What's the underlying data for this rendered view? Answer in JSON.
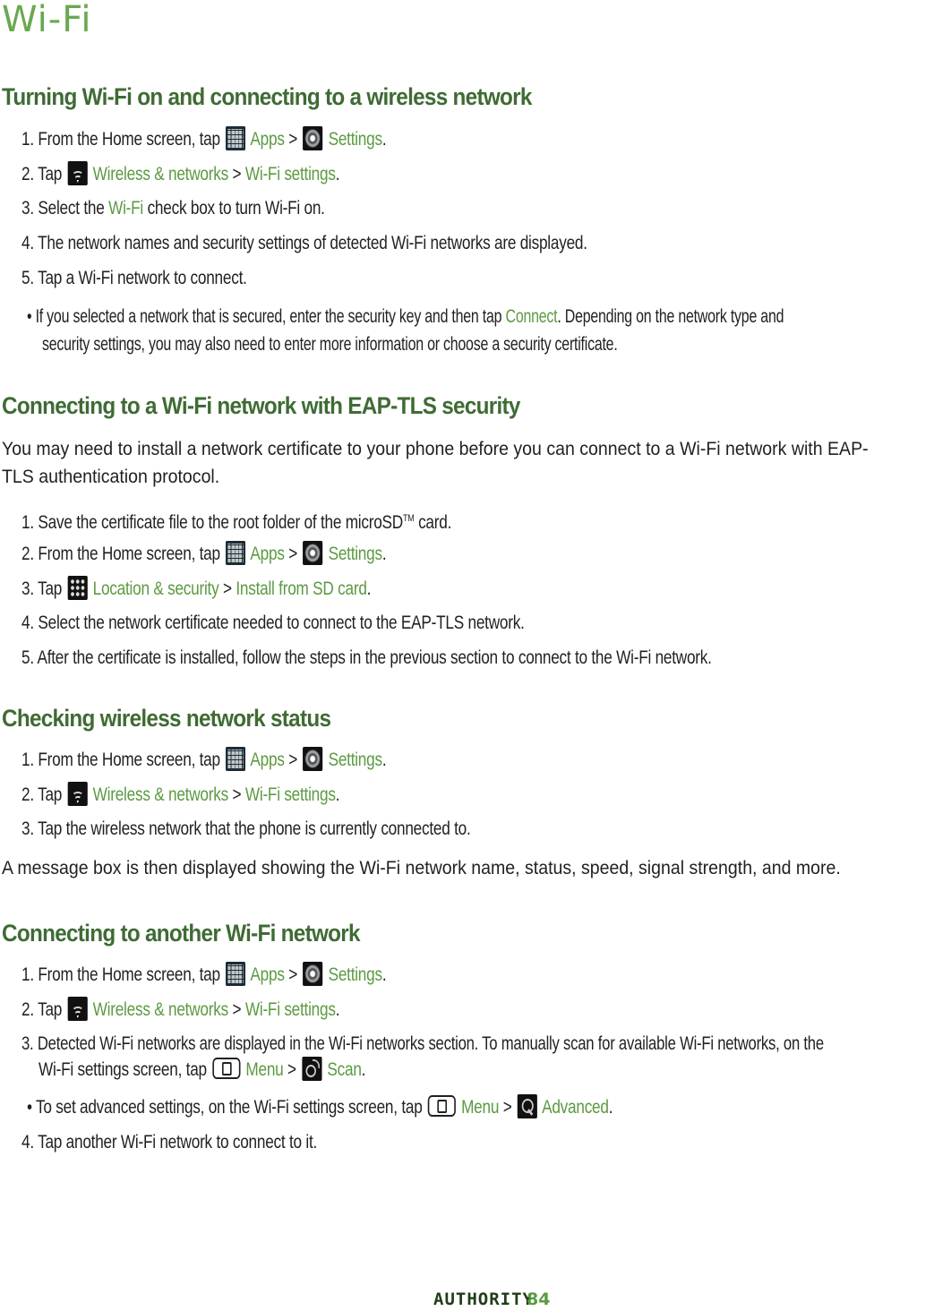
{
  "page": {
    "title": "Wi-Fi",
    "footer_brand": "AUTHORITY",
    "page_number": "84"
  },
  "sections": {
    "s1": {
      "heading": "Turning Wi-Fi on and connecting to a wireless network",
      "step1": {
        "pre": "1. From the Home screen, tap",
        "apps": "Apps",
        "sep": ">",
        "settings": "Settings",
        "end": "."
      },
      "step2": {
        "pre": "2. Tap",
        "link1": "Wireless & networks",
        "sep": ">",
        "link2": "Wi-Fi settings",
        "end": "."
      },
      "step3": {
        "pre": "3. Select the",
        "link": "Wi-Fi",
        "post": "check box to turn Wi-Fi on."
      },
      "step4": "4. The network names and security settings of detected Wi-Fi networks are displayed.",
      "step5": "5. Tap a Wi-Fi network to connect.",
      "bullet": {
        "pre": "• If you selected a network that is secured, enter the security key and then tap",
        "link": "Connect",
        "post": ". Depending on the network type and",
        "line2": "security settings, you may also need to enter more information or choose a security certificate."
      }
    },
    "s2": {
      "heading": "Connecting to a Wi-Fi network with EAP-TLS security",
      "intro_line1": "You may need to install a network certificate to your phone before you can connect to a Wi-Fi network with EAP-",
      "intro_line2": "TLS authentication protocol.",
      "step1": {
        "pre": "1. Save the certificate file to the root folder of the microSD",
        "tm": "TM",
        "post": " card."
      },
      "step2": {
        "pre": "2. From the Home screen, tap",
        "apps": "Apps",
        "sep": ">",
        "settings": "Settings",
        "end": "."
      },
      "step3": {
        "pre": "3. Tap",
        "link1": "Location & security",
        "sep": ">",
        "link2": "Install from SD card",
        "end": "."
      },
      "step4": "4. Select the network certificate needed to connect to the EAP-TLS network.",
      "step5": "5. After the certificate is installed, follow the steps in the previous section to connect to the Wi-Fi network."
    },
    "s3": {
      "heading": "Checking wireless network status",
      "step1": {
        "pre": "1. From the Home screen, tap",
        "apps": "Apps",
        "sep": ">",
        "settings": "Settings",
        "end": "."
      },
      "step2": {
        "pre": "2. Tap",
        "link1": "Wireless & networks",
        "sep": ">",
        "link2": "Wi-Fi settings",
        "end": "."
      },
      "step3": "3. Tap the wireless network that the phone is currently connected to.",
      "note": "A message box is then displayed showing the Wi-Fi network name, status, speed, signal strength, and more."
    },
    "s4": {
      "heading": "Connecting to another Wi-Fi network",
      "step1": {
        "pre": "1. From the Home screen, tap",
        "apps": "Apps",
        "sep": ">",
        "settings": "Settings",
        "end": "."
      },
      "step2": {
        "pre": "2. Tap",
        "link1": "Wireless & networks",
        "sep": ">",
        "link2": "Wi-Fi settings",
        "end": "."
      },
      "step3": {
        "line1": "3. Detected Wi-Fi networks are displayed in the Wi-Fi networks section. To manually scan for available Wi-Fi networks, on the",
        "pre2": "Wi-Fi settings screen, tap",
        "menu": "Menu",
        "sep": ">",
        "scan": "Scan",
        "end": "."
      },
      "bullet": {
        "pre": "• To set advanced settings, on the Wi-Fi settings screen, tap",
        "menu": "Menu",
        "sep": ">",
        "advanced": "Advanced",
        "end": "."
      },
      "step4": "4. Tap another Wi-Fi network to connect to it."
    }
  }
}
